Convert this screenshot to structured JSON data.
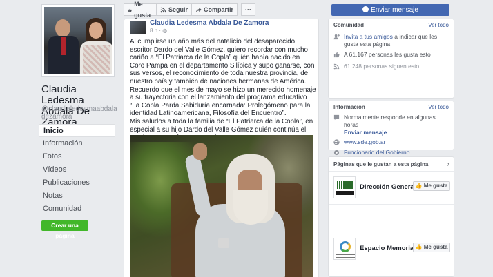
{
  "profile": {
    "name": "Claudia Ledesma Abdala De Zamora",
    "handle": "@claudialedesmaabdaladezamora"
  },
  "nav": {
    "items": [
      {
        "label": "Inicio",
        "active": true
      },
      {
        "label": "Información"
      },
      {
        "label": "Fotos"
      },
      {
        "label": "Vídeos"
      },
      {
        "label": "Publicaciones"
      },
      {
        "label": "Notas"
      },
      {
        "label": "Comunidad"
      }
    ],
    "create_page": "Crear una página"
  },
  "actions": {
    "like": "Me gusta",
    "follow": "Seguir",
    "share": "Compartir",
    "more": "···",
    "send_message": "Enviar mensaje"
  },
  "post": {
    "author": "Claudia Ledesma Abdala De Zamora",
    "time": "8 h · ",
    "paragraphs": [
      "Al cumplirse un año más del natalicio del desaparecido escritor Dardo del Valle Gómez, quiero recordar con mucho cariño a “El Patriarca de la Copla” quién había nacido en Coro Pampa en el departamento Silípica y supo ganarse, con sus versos, el reconocimiento de toda nuestra provincia, de nuestro país y también de naciones hermanas de América.",
      "Recuerdo que el mes de mayo se hizo un merecido homenaje a su trayectoria con el lanzamiento del programa educativo “La Copla Parda Sabiduría encarnada: Prolegómeno para la identidad Latinoamericana, Filosofía del Encuentro”.",
      "Mis saludos a toda la familia de “El Patriarca de la Copla”, en especial a su hijo Dardo del Valle Gómez quién continúa el sendero marcado por su padre …"
    ]
  },
  "community": {
    "title": "Comunidad",
    "see_all": "Ver todo",
    "invite_link": "Invita a tus amigos",
    "invite_rest": " a indicar que les gusta esta página",
    "likes": "A 61.167 personas les gusta esto",
    "follows": "61.248 personas siguen esto"
  },
  "info": {
    "title": "Información",
    "see_all": "Ver todo",
    "response": "Normalmente responde en algunas horas",
    "send_message": "Enviar mensaje",
    "website": "www.sde.gob.ar",
    "category": "Funcionario del Gobierno"
  },
  "liked_pages": {
    "title": "Páginas que le gustan a esta página",
    "chevron": "›",
    "items": [
      {
        "name": "Dirección Genera…",
        "button": "Me gusta"
      },
      {
        "name": "Espacio Memoria…",
        "button": "Me gusta"
      }
    ]
  },
  "colors": {
    "brand_blue": "#4267b2",
    "link": "#385898",
    "green": "#42b72a",
    "background": "#e9ebee"
  }
}
